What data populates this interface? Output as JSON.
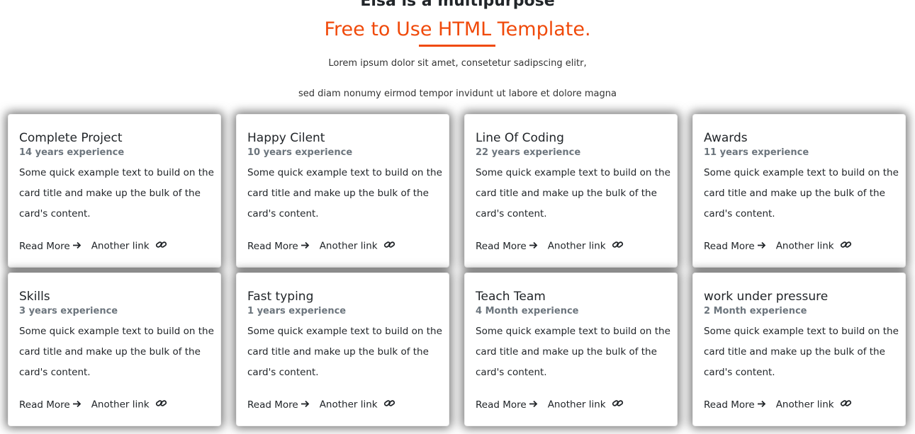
{
  "header": {
    "kicker": "Elsa is a multipurpose",
    "headline": "Free to Use HTML Template.",
    "lead_line1": "Lorem ipsum dolor sit amet, consetetur sadipscing elitr,",
    "lead_line2": "sed diam nonumy eirmod tempor invidunt ut labore et dolore magna"
  },
  "colors": {
    "accent": "#f04a0b",
    "text": "#212529",
    "muted": "#6c757d"
  },
  "cards": [
    {
      "title": "Complete Project",
      "subtitle": "14 years experience",
      "text": "Some quick example text to build on the card title and make up the bulk of the card's content.",
      "link1": "Read More",
      "link1_icon": "arrow-right-icon",
      "link2": "Another link",
      "link2_icon": "link-icon"
    },
    {
      "title": "Happy Cilent",
      "subtitle": "10 years experience",
      "text": "Some quick example text to build on the card title and make up the bulk of the card's content.",
      "link1": "Read More",
      "link1_icon": "arrow-right-icon",
      "link2": "Another link",
      "link2_icon": "link-icon"
    },
    {
      "title": "Line Of Coding",
      "subtitle": "22 years experience",
      "text": "Some quick example text to build on the card title and make up the bulk of the card's content.",
      "link1": "Read More",
      "link1_icon": "arrow-right-icon",
      "link2": "Another link",
      "link2_icon": "link-icon"
    },
    {
      "title": "Awards",
      "subtitle": "11 years experience",
      "text": "Some quick example text to build on the card title and make up the bulk of the card's content.",
      "link1": "Read More",
      "link1_icon": "arrow-right-icon",
      "link2": "Another link",
      "link2_icon": "link-icon"
    },
    {
      "title": "Skills",
      "subtitle": "3 years experience",
      "text": "Some quick example text to build on the card title and make up the bulk of the card's content.",
      "link1": "Read More",
      "link1_icon": "arrow-right-icon",
      "link2": "Another link",
      "link2_icon": "link-icon"
    },
    {
      "title": "Fast typing",
      "subtitle": "1 years experience",
      "text": "Some quick example text to build on the card title and make up the bulk of the card's content.",
      "link1": "Read More",
      "link1_icon": "arrow-right-icon",
      "link2": "Another link",
      "link2_icon": "link-icon"
    },
    {
      "title": "Teach Team",
      "subtitle": "4 Month experience",
      "text": "Some quick example text to build on the card title and make up the bulk of the card's content.",
      "link1": "Read More",
      "link1_icon": "arrow-right-icon",
      "link2": "Another link",
      "link2_icon": "link-icon"
    },
    {
      "title": "work under pressure",
      "subtitle": "2 Month experience",
      "text": "Some quick example text to build on the card title and make up the bulk of the card's content.",
      "link1": "Read More",
      "link1_icon": "arrow-right-icon",
      "link2": "Another link",
      "link2_icon": "link-icon"
    }
  ]
}
